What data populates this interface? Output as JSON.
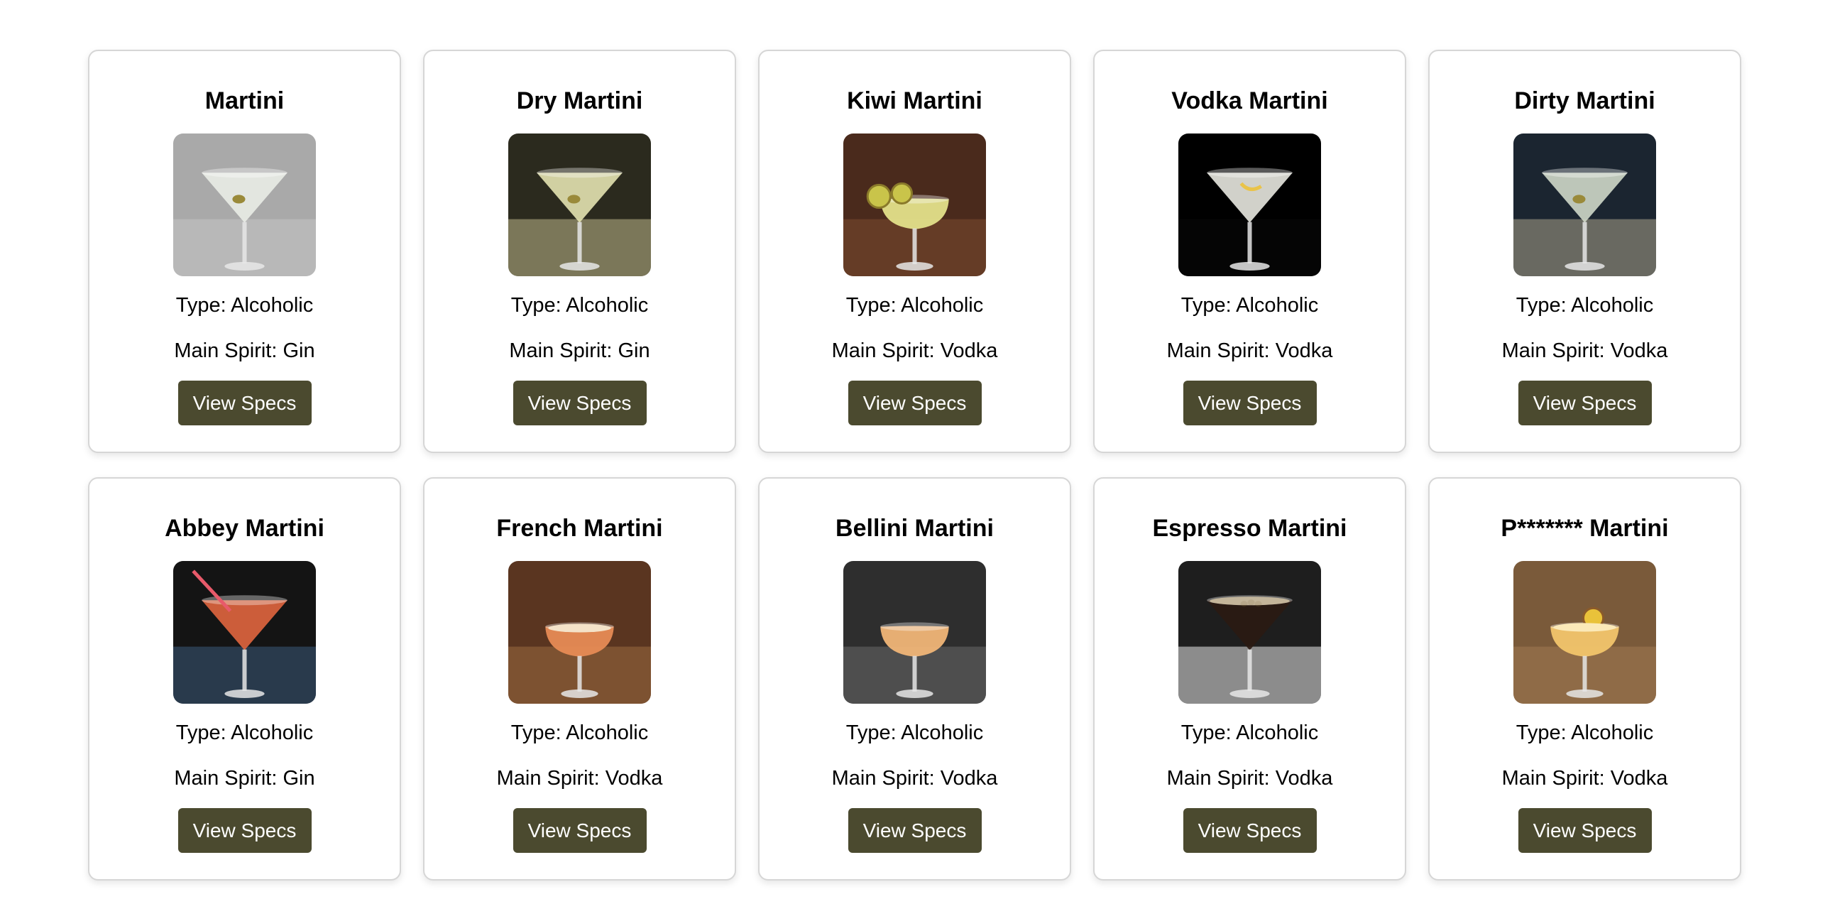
{
  "cocktails": [
    {
      "name": "Martini",
      "type_label": "Type: Alcoholic",
      "spirit_label": "Main Spirit: Gin",
      "button_label": "View Specs",
      "photo": {
        "bg": "#a9a9a9",
        "bg2": "#c4c4c4",
        "drink": "#e9ece6",
        "style": "martini",
        "garnish": "olive"
      }
    },
    {
      "name": "Dry Martini",
      "type_label": "Type: Alcoholic",
      "spirit_label": "Main Spirit: Gin",
      "button_label": "View Specs",
      "photo": {
        "bg": "#2b2a1e",
        "bg2": "#bdb68a",
        "drink": "#e3e2b0",
        "style": "martini",
        "garnish": "olive"
      }
    },
    {
      "name": "Kiwi Martini",
      "type_label": "Type: Alcoholic",
      "spirit_label": "Main Spirit: Vodka",
      "button_label": "View Specs",
      "photo": {
        "bg": "#4a2a1c",
        "bg2": "#7b4a30",
        "drink": "#e3e08a",
        "style": "coupe",
        "garnish": "kiwi"
      }
    },
    {
      "name": "Vodka Martini",
      "type_label": "Type: Alcoholic",
      "spirit_label": "Main Spirit: Vodka",
      "button_label": "View Specs",
      "photo": {
        "bg": "#000000",
        "bg2": "#0a0a0a",
        "drink": "#e8e8e0",
        "style": "martini",
        "garnish": "twist"
      }
    },
    {
      "name": "Dirty Martini",
      "type_label": "Type: Alcoholic",
      "spirit_label": "Main Spirit: Vodka",
      "button_label": "View Specs",
      "photo": {
        "bg": "#1b2530",
        "bg2": "#a9a28a",
        "drink": "#cfd8c9",
        "style": "martini",
        "garnish": "olive"
      }
    },
    {
      "name": "Abbey Martini",
      "type_label": "Type: Alcoholic",
      "spirit_label": "Main Spirit: Gin",
      "button_label": "View Specs",
      "photo": {
        "bg": "#141414",
        "bg2": "#3a5a7a",
        "drink": "#e0653e",
        "style": "martini",
        "garnish": "straw"
      }
    },
    {
      "name": "French Martini",
      "type_label": "Type: Alcoholic",
      "spirit_label": "Main Spirit: Vodka",
      "button_label": "View Specs",
      "photo": {
        "bg": "#5a3520",
        "bg2": "#9a6a40",
        "drink": "#e78b55",
        "style": "coupe",
        "garnish": "foam"
      }
    },
    {
      "name": "Bellini Martini",
      "type_label": "Type: Alcoholic",
      "spirit_label": "Main Spirit: Vodka",
      "button_label": "View Specs",
      "photo": {
        "bg": "#2e2e2e",
        "bg2": "#6a6a6a",
        "drink": "#f0b577",
        "style": "coupe",
        "garnish": "none"
      }
    },
    {
      "name": "Espresso Martini",
      "type_label": "Type: Alcoholic",
      "spirit_label": "Main Spirit: Vodka",
      "button_label": "View Specs",
      "photo": {
        "bg": "#1e1e1e",
        "bg2": "#e8e8e8",
        "drink": "#2a1a12",
        "style": "martini",
        "garnish": "beans"
      }
    },
    {
      "name": "P******* Martini",
      "type_label": "Type: Alcoholic",
      "spirit_label": "Main Spirit: Vodka",
      "button_label": "View Specs",
      "photo": {
        "bg": "#7a5a3a",
        "bg2": "#a07a52",
        "drink": "#f2c56c",
        "style": "coupe",
        "garnish": "passionfruit"
      }
    }
  ]
}
